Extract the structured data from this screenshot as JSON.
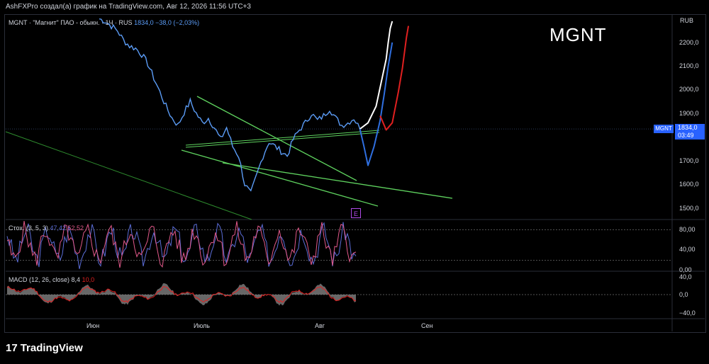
{
  "header": {
    "text": "AshFXPro создал(а) график на TradingView.com, Авг 12, 2026 11:56 UTC+3"
  },
  "legend": {
    "name": "MGNT · \"Магнит\" ПАО - обыкн. · 1Ч · RUS",
    "values": "1834,0 −38,0 (−2,03%)"
  },
  "big_title": "MGNT",
  "currency": "RUB",
  "price_tag": {
    "symbol": "MGNT",
    "price": "1834,0",
    "countdown": "03:49"
  },
  "event_badge": "E",
  "stoch_legend": {
    "name": "Стох. (3, 5, 3)",
    "k": "47,42",
    "d": "52,52"
  },
  "macd_legend": {
    "name": "MACD (12, 26, close)",
    "hist": "8,4",
    "signal": "10,0"
  },
  "price_ticks": [
    "2200,0",
    "2100,0",
    "2000,0",
    "1900,0",
    "1700,0",
    "1600,0",
    "1500,0"
  ],
  "stoch_ticks": [
    "80,00",
    "40,00",
    "0,00"
  ],
  "macd_ticks": [
    "40,0",
    "0,0",
    "−40,0"
  ],
  "x_ticks": [
    "Июн",
    "Июль",
    "Авг",
    "Сен"
  ],
  "brand": "TradingView",
  "colors": {
    "price": "#5b9cf6",
    "wedge": "#5fd35f",
    "stoch_k": "#5b6dd8",
    "stoch_d": "#e2598a",
    "forecast_red": "#e02020",
    "forecast_blue": "#2f6fe0",
    "forecast_white": "#ffffff",
    "accent": "#2962ff"
  },
  "chart_data": {
    "type": "line",
    "title": "MGNT",
    "ylabel": "RUB",
    "ylim": [
      1470,
      2290
    ],
    "x_categories": [
      "Июн",
      "Июль",
      "Авг",
      "Сен"
    ],
    "price_series": {
      "name": "MGNT",
      "points": [
        [
          0,
          2300
        ],
        [
          3,
          2290
        ],
        [
          6,
          2270
        ],
        [
          9,
          2250
        ],
        [
          12,
          2210
        ],
        [
          15,
          2185
        ],
        [
          18,
          2175
        ],
        [
          21,
          2150
        ],
        [
          24,
          2110
        ],
        [
          27,
          2050
        ],
        [
          30,
          1990
        ],
        [
          33,
          1930
        ],
        [
          36,
          1880
        ],
        [
          39,
          1850
        ],
        [
          42,
          1905
        ],
        [
          45,
          1950
        ],
        [
          48,
          1900
        ],
        [
          51,
          1860
        ],
        [
          54,
          1880
        ],
        [
          57,
          1840
        ],
        [
          60,
          1790
        ],
        [
          63,
          1840
        ],
        [
          66,
          1760
        ],
        [
          69,
          1720
        ],
        [
          72,
          1600
        ],
        [
          75,
          1560
        ],
        [
          78,
          1640
        ],
        [
          81,
          1720
        ],
        [
          84,
          1780
        ],
        [
          87,
          1760
        ],
        [
          90,
          1740
        ],
        [
          93,
          1720
        ],
        [
          96,
          1790
        ],
        [
          99,
          1830
        ],
        [
          102,
          1860
        ],
        [
          105,
          1900
        ],
        [
          108,
          1870
        ],
        [
          111,
          1890
        ],
        [
          114,
          1920
        ],
        [
          117,
          1880
        ],
        [
          120,
          1850
        ],
        [
          123,
          1860
        ],
        [
          126,
          1880
        ],
        [
          129,
          1834
        ]
      ]
    },
    "forecasts": [
      {
        "color": "white",
        "points": [
          [
            129,
            1834
          ],
          [
            133,
            1860
          ],
          [
            137,
            1930
          ],
          [
            140,
            2050
          ],
          [
            142,
            2130
          ],
          [
            143,
            2200
          ],
          [
            144,
            2260
          ],
          [
            145,
            2290
          ]
        ]
      },
      {
        "color": "blue",
        "points": [
          [
            129,
            1834
          ],
          [
            131,
            1760
          ],
          [
            133,
            1680
          ],
          [
            136,
            1760
          ],
          [
            139,
            1870
          ],
          [
            141,
            1980
          ],
          [
            143,
            2100
          ],
          [
            145,
            2200
          ]
        ]
      },
      {
        "color": "red",
        "points": [
          [
            139,
            1890
          ],
          [
            142,
            1830
          ],
          [
            145,
            1860
          ],
          [
            148,
            1990
          ],
          [
            150,
            2090
          ],
          [
            152,
            2220
          ],
          [
            153,
            2270
          ]
        ]
      }
    ],
    "stochastic": {
      "k": 47.42,
      "d": 52.52,
      "range": [
        0,
        100
      ],
      "levels": [
        80,
        20
      ]
    },
    "macd": {
      "hist": 8.4,
      "signal": 10.0,
      "range": [
        -50,
        50
      ]
    }
  }
}
